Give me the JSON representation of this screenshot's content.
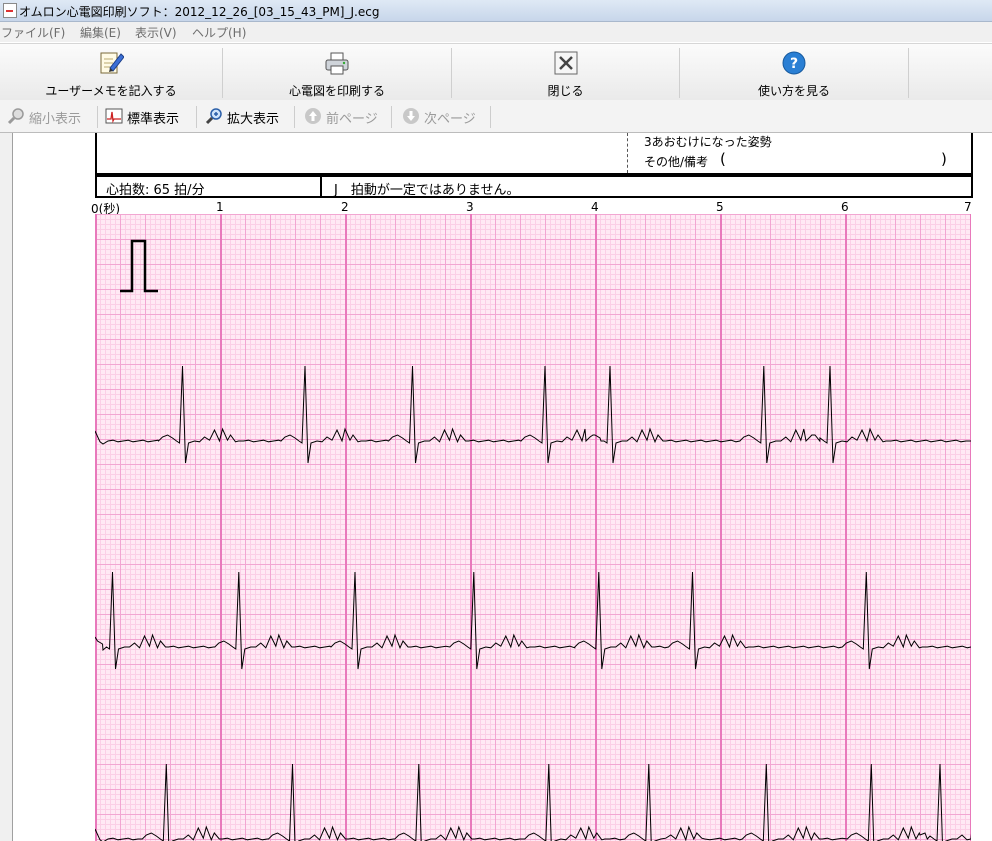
{
  "window": {
    "title": "オムロン心電図印刷ソフト：2012_12_26_[03_15_43_PM]_J.ecg"
  },
  "menu": {
    "items": [
      "ファイル(F)",
      "編集(E)",
      "表示(V)",
      "ヘルプ(H)"
    ]
  },
  "toolbar": {
    "memo_label": "ユーザーメモを記入する",
    "print_label": "心電図を印刷する",
    "close_label": "閉じる",
    "help_label": "使い方を見る"
  },
  "nav": {
    "zoom_out": "縮小表示",
    "normal": "標準表示",
    "zoom_in": "拡大表示",
    "prev": "前ページ",
    "next": "次ページ"
  },
  "record": {
    "posture": "3あおむけになった姿勢",
    "remarks_label": "その他/備考",
    "paren_open": "(",
    "paren_close": ")",
    "heart_rate": "心拍数: 65 拍/分",
    "message": "J　拍動が一定ではありません。"
  },
  "colors": {
    "grid_major": "#e879bb",
    "grid_minor": "#f2a6d2",
    "grid_fine": "#fbcfe6",
    "paper": "#ffe9f4"
  },
  "chart_data": {
    "type": "line",
    "x_ticks": [
      "0(秒)",
      "1",
      "2",
      "3",
      "4",
      "5",
      "6",
      "7"
    ],
    "xlim": [
      0,
      7
    ],
    "calibration_pulse": true,
    "grid": true,
    "series": [
      {
        "beats_s": [
          0.7,
          1.68,
          2.54,
          3.6,
          4.12,
          5.35,
          5.88
        ]
      },
      {
        "beats_s": [
          0.14,
          1.15,
          2.08,
          3.03,
          4.03,
          4.78,
          6.17
        ]
      },
      {
        "beats_s": [
          0.57,
          1.58,
          2.59,
          3.63,
          4.43,
          5.37,
          6.21,
          6.76
        ]
      }
    ]
  }
}
